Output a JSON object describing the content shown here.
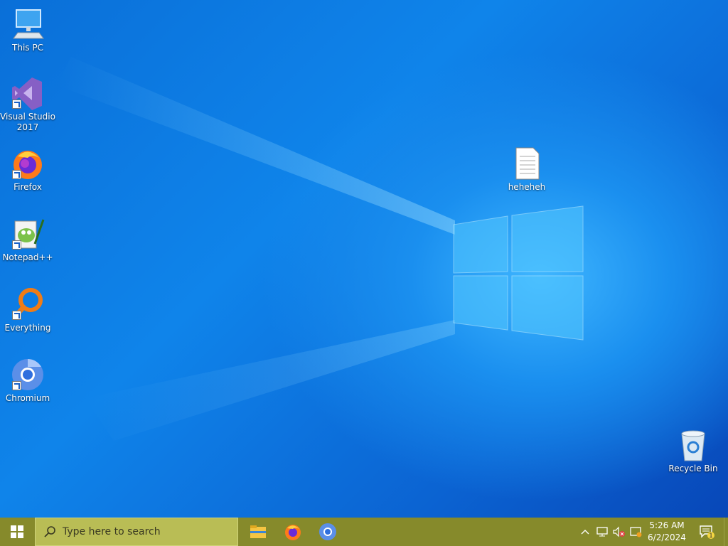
{
  "desktop": {
    "icons_left": [
      {
        "label": "This PC",
        "icon": "this-pc-icon"
      },
      {
        "label": "Visual Studio 2017",
        "icon": "visual-studio-icon"
      },
      {
        "label": "Firefox",
        "icon": "firefox-icon"
      },
      {
        "label": "Notepad++",
        "icon": "notepad-plus-plus-icon"
      },
      {
        "label": "Everything",
        "icon": "everything-icon"
      },
      {
        "label": "Chromium",
        "icon": "chromium-icon"
      }
    ],
    "file_icon": {
      "label": "heheheh",
      "icon": "text-file-icon"
    },
    "recycle_bin": {
      "label": "Recycle Bin",
      "icon": "recycle-bin-icon"
    }
  },
  "taskbar": {
    "search_placeholder": "Type here to search",
    "pinned_apps": [
      "file-explorer-icon",
      "firefox-icon",
      "chromium-icon"
    ],
    "tray_icons": [
      "chevron-up-icon",
      "network-icon",
      "volume-muted-icon",
      "action-center-icon"
    ],
    "clock": {
      "time": "5:26 AM",
      "date": "6/2/2024"
    },
    "notification_count": "1",
    "colors": {
      "taskbar": "#868a2b",
      "search": "#b9bd55"
    }
  }
}
